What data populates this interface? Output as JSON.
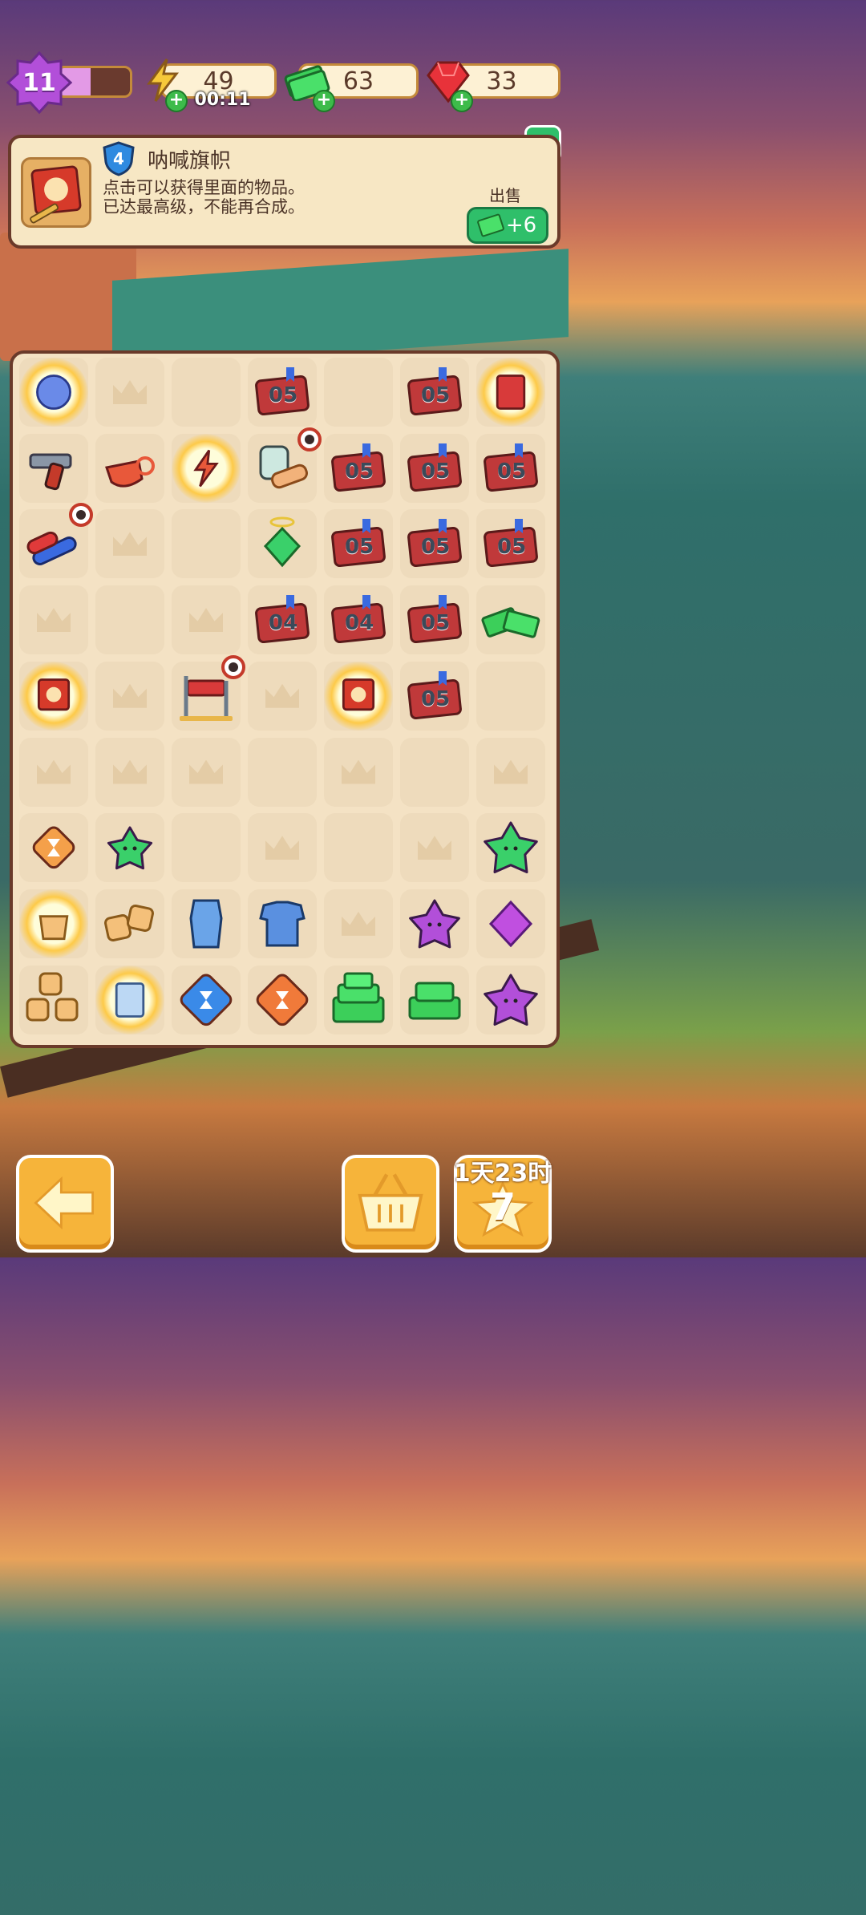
{
  "topbar": {
    "level": "11",
    "level_progress": 0.45,
    "energy": "49",
    "energy_timer": "00:11",
    "cash": "63",
    "gems": "33"
  },
  "info": {
    "item_level": "4",
    "title": "呐喊旗帜",
    "desc_line1": "点击可以获得里面的物品。",
    "desc_line2": "已达最高级，不能再合成。",
    "sell_label": "出售",
    "sell_value": "+6"
  },
  "board": {
    "rows": [
      [
        "glow-orb",
        "crown",
        "empty",
        "card-05",
        "empty",
        "card-05",
        "glow-box"
      ],
      [
        "toy-gun",
        "whistle",
        "glow-energy",
        "bandage-clock",
        "card-05",
        "card-05",
        "card-05"
      ],
      [
        "lipstick-clock",
        "crown",
        "empty",
        "green-angel",
        "card-05",
        "card-05",
        "card-05"
      ],
      [
        "crown",
        "empty",
        "crown",
        "card-04",
        "card-04",
        "card-05",
        "cash-stack"
      ],
      [
        "glow-flag",
        "crown",
        "barrier-clock",
        "crown",
        "glow-flag",
        "card-05",
        "empty"
      ],
      [
        "crown",
        "crown",
        "crown",
        "empty",
        "crown",
        "empty",
        "crown"
      ],
      [
        "hourglass-orange-small",
        "star-angel",
        "empty",
        "crown",
        "empty",
        "crown",
        "star-angel-big"
      ],
      [
        "glow-bag",
        "cookies-2",
        "blue-dress",
        "blue-shirt",
        "crown",
        "purple-star",
        "purple-gem"
      ],
      [
        "cookies-3",
        "glow-paper",
        "hourglass-blue",
        "hourglass-orange",
        "cash-big",
        "cash-mid",
        "purple-flower"
      ]
    ],
    "card_labels": {
      "card-05": "05",
      "card-04": "04"
    }
  },
  "bottom": {
    "event_time": "1天23时",
    "event_count": "7"
  },
  "colors": {
    "accent_orange": "#f6b43a",
    "green": "#2fbf6a",
    "panel": "#f7e7c4"
  }
}
